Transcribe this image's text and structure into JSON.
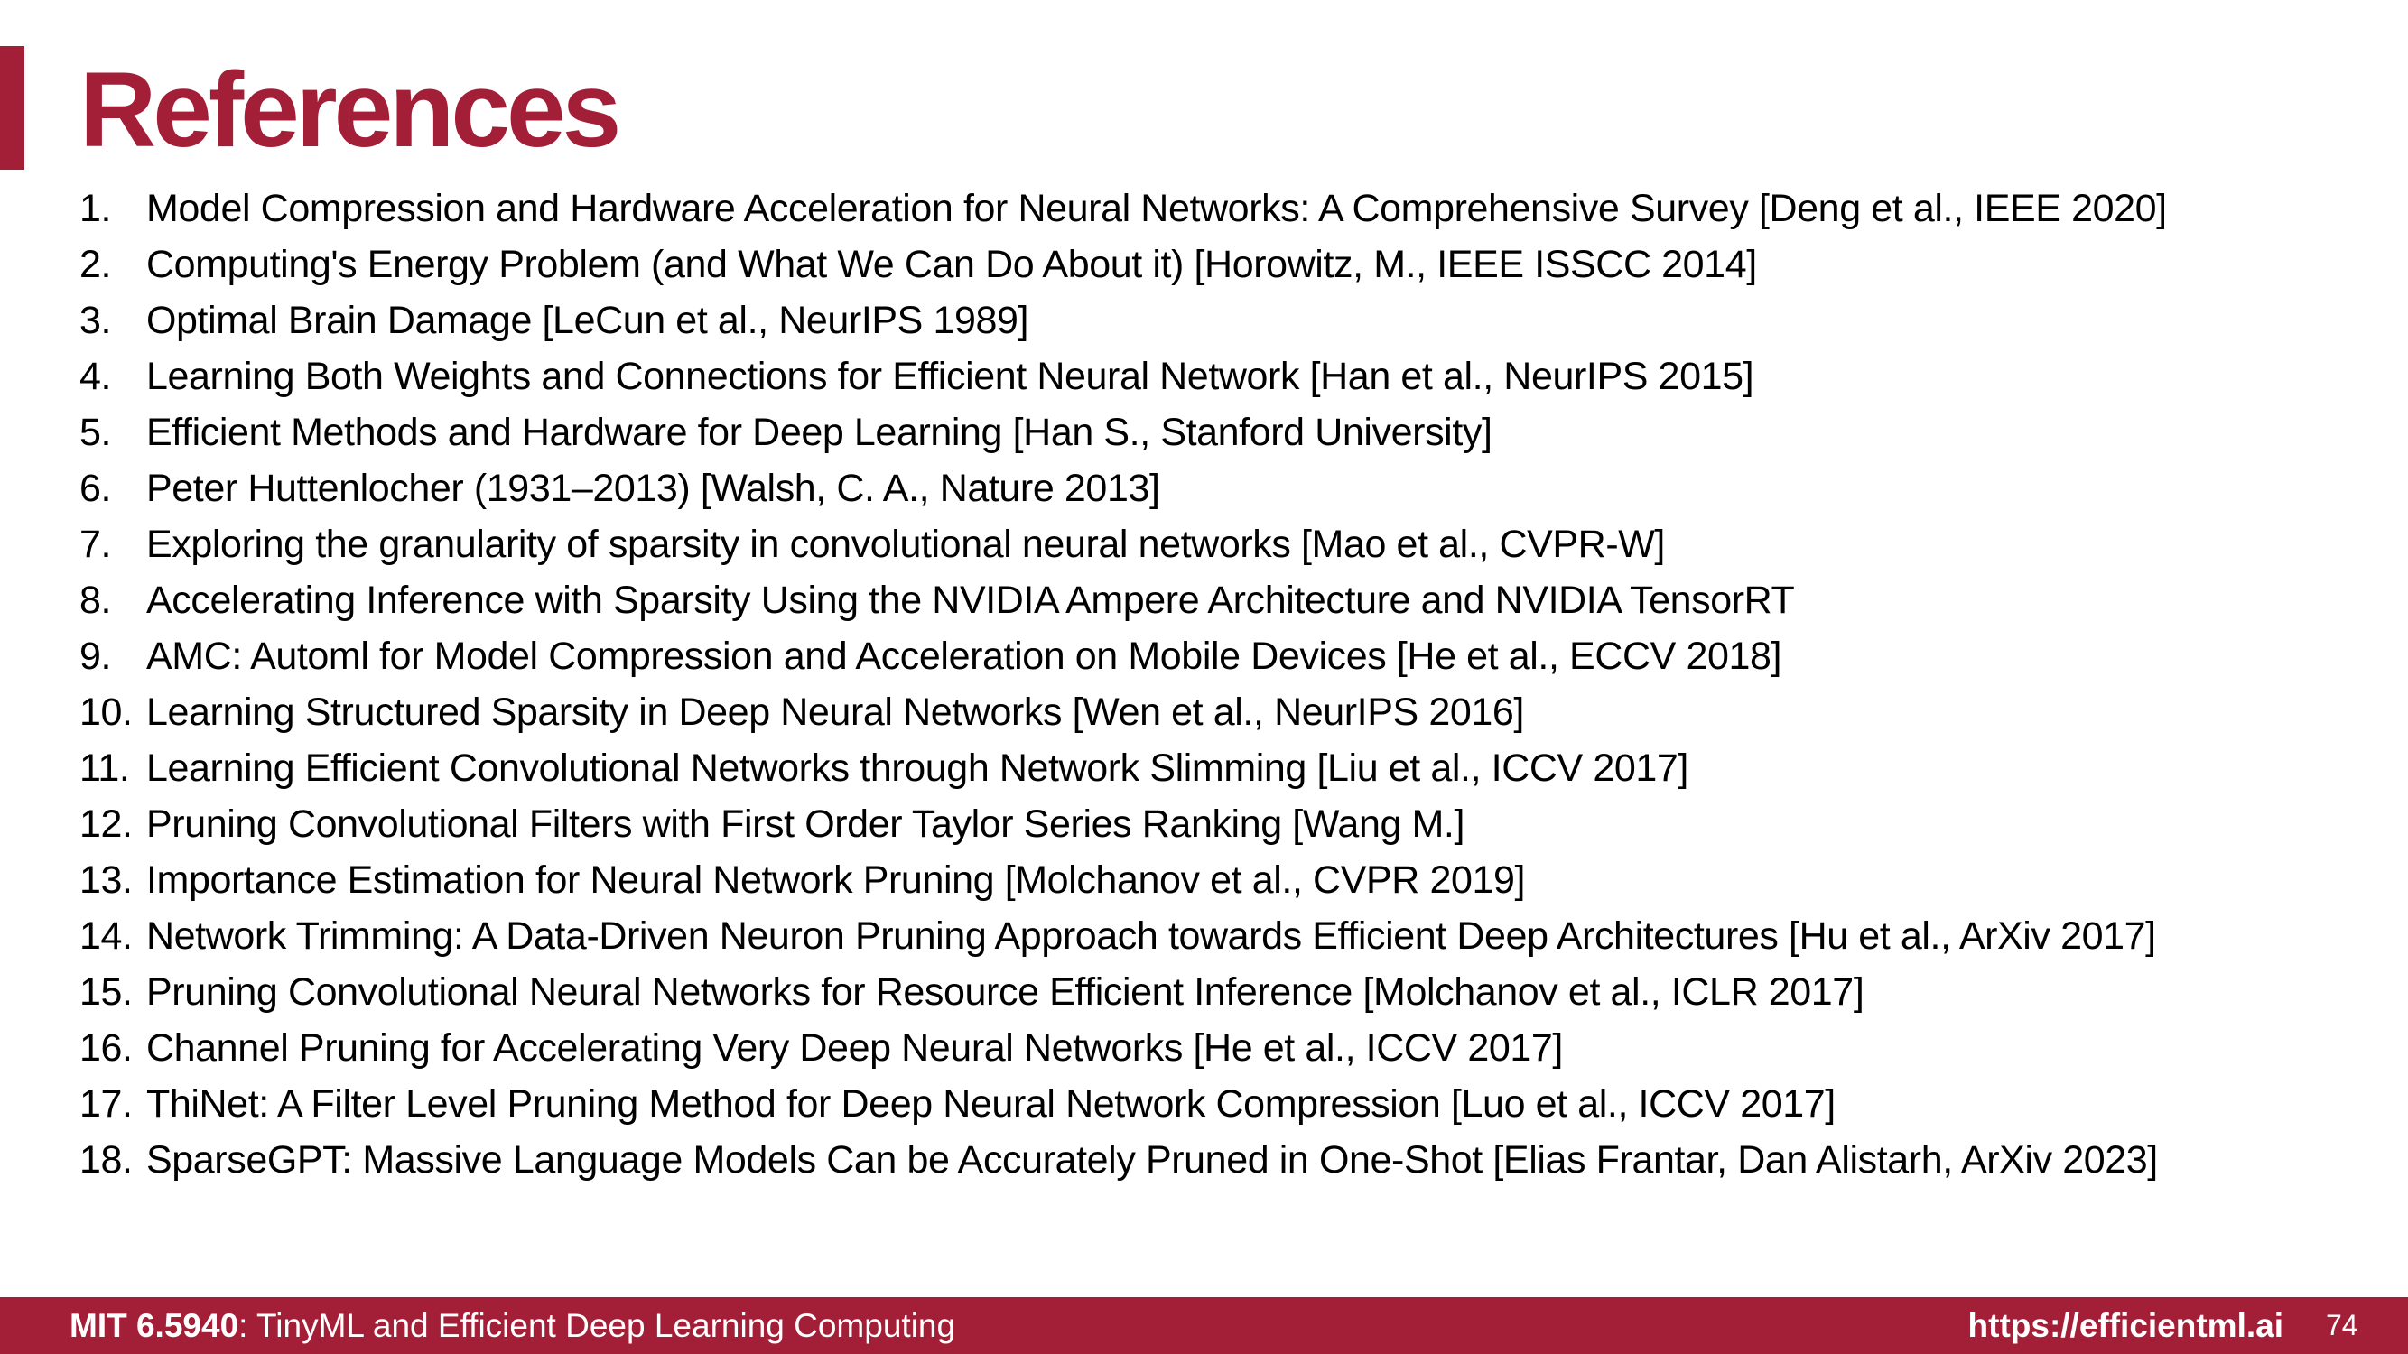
{
  "title": "References",
  "references": [
    {
      "num": "1.",
      "text": "Model Compression and Hardware Acceleration for Neural Networks: A Comprehensive Survey [Deng et al., IEEE 2020]"
    },
    {
      "num": "2.",
      "text": "Computing's Energy Problem (and What We Can Do About it) [Horowitz, M., IEEE ISSCC 2014]"
    },
    {
      "num": "3.",
      "text": "Optimal Brain Damage [LeCun et al., NeurIPS 1989]"
    },
    {
      "num": "4.",
      "text": "Learning Both Weights and Connections for Efficient Neural Network [Han et al., NeurIPS 2015]"
    },
    {
      "num": "5.",
      "text": "Efficient Methods and Hardware for Deep Learning [Han S., Stanford University]"
    },
    {
      "num": "6.",
      "text": "Peter Huttenlocher (1931–2013) [Walsh, C. A., Nature 2013]"
    },
    {
      "num": "7.",
      "text": "Exploring the granularity of sparsity in convolutional neural networks [Mao et al., CVPR-W]"
    },
    {
      "num": "8.",
      "text": "Accelerating Inference with Sparsity Using the NVIDIA Ampere Architecture and NVIDIA TensorRT"
    },
    {
      "num": "9.",
      "text": "AMC: Automl for Model Compression and Acceleration on Mobile Devices [He et al., ECCV 2018]"
    },
    {
      "num": "10.",
      "text": "Learning Structured Sparsity in Deep Neural Networks [Wen et al., NeurIPS 2016]"
    },
    {
      "num": "11.",
      "text": "Learning Efficient Convolutional Networks through Network Slimming [Liu et al., ICCV 2017]"
    },
    {
      "num": "12.",
      "text": "Pruning Convolutional Filters with First Order Taylor Series Ranking [Wang M.]"
    },
    {
      "num": "13.",
      "text": "Importance Estimation for Neural Network Pruning [Molchanov et al., CVPR 2019]"
    },
    {
      "num": "14.",
      "text": "Network Trimming: A Data-Driven Neuron Pruning Approach towards Efficient Deep Architectures [Hu et al., ArXiv 2017]"
    },
    {
      "num": "15.",
      "text": "Pruning Convolutional Neural Networks for Resource Efficient Inference [Molchanov et al., ICLR 2017]"
    },
    {
      "num": "16.",
      "text": "Channel Pruning for Accelerating Very Deep Neural Networks [He et al., ICCV 2017]"
    },
    {
      "num": "17.",
      "text": "ThiNet: A Filter Level Pruning Method for Deep Neural Network Compression [Luo et al., ICCV 2017]"
    },
    {
      "num": "18.",
      "text": "SparseGPT: Massive Language Models Can be Accurately Pruned in One-Shot [Elias Frantar, Dan Alistarh, ArXiv 2023]"
    }
  ],
  "footer": {
    "course_code": "MIT 6.5940",
    "course_title": ": TinyML and Efficient Deep Learning Computing",
    "url": "https://efficientml.ai",
    "page_number": "74"
  },
  "colors": {
    "accent": "#a31f37",
    "text": "#000000",
    "background": "#ffffff"
  }
}
